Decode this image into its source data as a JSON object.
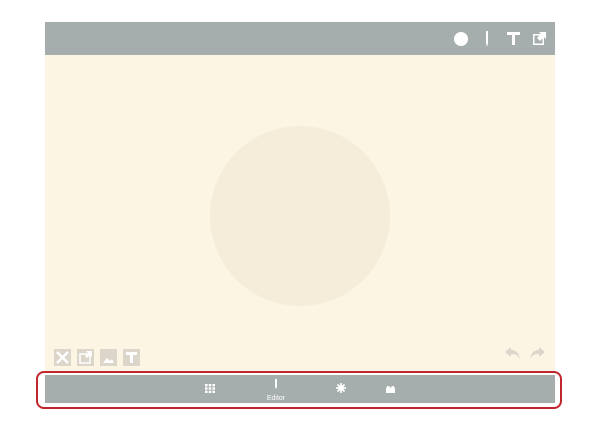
{
  "colors": {
    "toolbar_bg": "#a5aeac",
    "canvas_bg": "#fdf5e3",
    "circle_fill": "#f5ecd9",
    "highlight": "#c0262d",
    "icon_white": "#ffffff",
    "icon_faded": "#dcd6ca"
  },
  "top_toolbar": {
    "tools": [
      {
        "name": "brush-size-icon"
      },
      {
        "name": "pen-icon"
      },
      {
        "name": "text-icon"
      },
      {
        "name": "export-icon"
      }
    ]
  },
  "canvas": {
    "bottom_left_tools": [
      {
        "name": "delete-icon"
      },
      {
        "name": "export-image-icon"
      },
      {
        "name": "image-icon"
      },
      {
        "name": "text-box-icon"
      }
    ],
    "bottom_right_tools": [
      {
        "name": "undo-icon"
      },
      {
        "name": "redo-icon"
      }
    ]
  },
  "tabbar": {
    "tabs": [
      {
        "name": "grid-icon",
        "label": ""
      },
      {
        "name": "editor-icon",
        "label": "Editor"
      },
      {
        "name": "settings-icon",
        "label": ""
      },
      {
        "name": "store-icon",
        "label": ""
      }
    ]
  }
}
